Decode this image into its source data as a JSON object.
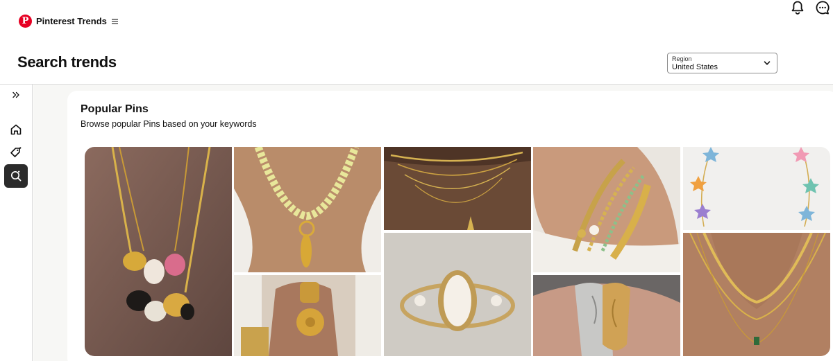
{
  "topbar": {
    "brand_name": "Pinterest Trends",
    "icons": [
      "pinterest-logo-icon",
      "hamburger-menu-icon",
      "notifications-bell-icon",
      "messages-icon"
    ]
  },
  "header": {
    "title": "Search trends",
    "region": {
      "label": "Region",
      "value": "United States"
    }
  },
  "sidenav": {
    "items": [
      {
        "icon": "expand-chevrons-icon"
      },
      {
        "icon": "home-icon"
      },
      {
        "icon": "tag-sparkle-icon"
      },
      {
        "icon": "search-trends-icon",
        "active": true
      }
    ]
  },
  "popular_pins": {
    "title": "Popular Pins",
    "subtitle": "Browse popular Pins based on your keywords",
    "pins": [
      {
        "subject": "gold chain necklaces with charm rings"
      },
      {
        "subject": "yellow bead necklace with gold pendant"
      },
      {
        "subject": "layered gold chain necklaces"
      },
      {
        "subject": "stacked gold bracelets"
      },
      {
        "subject": "star charm bracelet"
      },
      {
        "subject": "gold rings on hand"
      },
      {
        "subject": "pearl gold ring"
      },
      {
        "subject": "face sculpture rings"
      },
      {
        "subject": "layered gold necklace with green pendant"
      }
    ]
  },
  "colors": {
    "brand": "#e60023",
    "active_nav": "#2b2b2b",
    "background": "#f7f7f5"
  }
}
